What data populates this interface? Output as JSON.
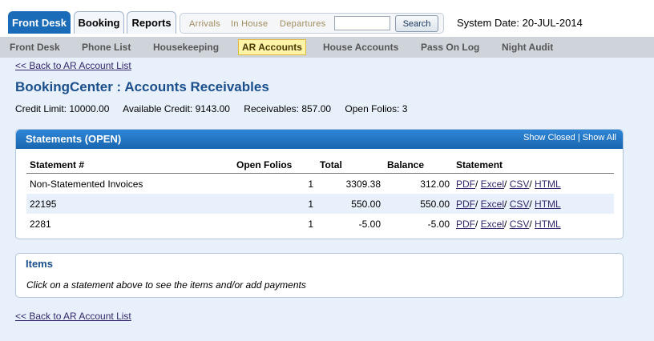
{
  "top_tabs": [
    "Front Desk",
    "Booking",
    "Reports"
  ],
  "quick_links": [
    "Arrivals",
    "In House",
    "Departures"
  ],
  "search": {
    "value": "",
    "button": "Search"
  },
  "system_date": "System Date: 20-JUL-2014",
  "sub_nav": [
    "Front Desk",
    "Phone List",
    "Housekeeping",
    "AR Accounts",
    "House Accounts",
    "Pass On Log",
    "Night Audit"
  ],
  "back_link": "<< Back to AR Account List",
  "page_title": "BookingCenter : Accounts Receivables",
  "summary": {
    "credit_limit": "Credit Limit: 10000.00",
    "available_credit": "Available Credit: 9143.00",
    "receivables": "Receivables: 857.00",
    "open_folios": "Open Folios: 3"
  },
  "statements": {
    "title": "Statements (OPEN)",
    "show_closed": "Show Closed",
    "separator": "|",
    "show_all": "Show All",
    "columns": [
      "Statement #",
      "Open Folios",
      "Total",
      "Balance",
      "Statement"
    ],
    "rows": [
      {
        "statement": "Non-Statemented Invoices",
        "open_folios": "1",
        "total": "3309.38",
        "balance": "312.00"
      },
      {
        "statement": "22195",
        "open_folios": "1",
        "total": "550.00",
        "balance": "550.00"
      },
      {
        "statement": "2281",
        "open_folios": "1",
        "total": "-5.00",
        "balance": "-5.00"
      }
    ],
    "export_links": [
      "PDF",
      "Excel",
      "CSV",
      "HTML"
    ]
  },
  "items": {
    "title": "Items",
    "message": "Click on a statement above to see the items and/or add payments"
  },
  "colors": {
    "tab_active": "#1a6cb9",
    "header_blue": "#1a4f8c",
    "link": "#33276b",
    "selected_nav": "#fff4a8"
  }
}
